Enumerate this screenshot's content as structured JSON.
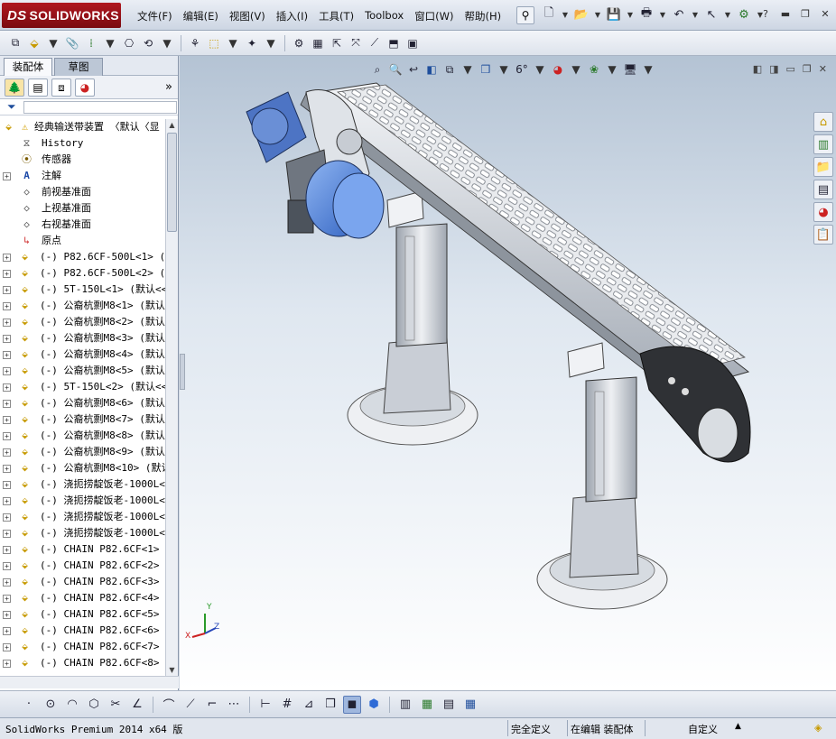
{
  "app": {
    "brand": "SOLIDWORKS",
    "brand_prefix": "DS"
  },
  "menu": [
    "文件(F)",
    "编辑(E)",
    "视图(V)",
    "插入(I)",
    "工具(T)",
    "Toolbox",
    "窗口(W)",
    "帮助(H)"
  ],
  "panel": {
    "tabs": [
      "装配体",
      "草图"
    ],
    "root": "经典输送带装置 〈默认〈显",
    "items": [
      {
        "icon": "history-icon",
        "label": "History",
        "expand": false
      },
      {
        "icon": "sensor-icon",
        "label": "传感器",
        "expand": false
      },
      {
        "icon": "annotation-icon",
        "label": "注解",
        "expand": true
      },
      {
        "icon": "plane-icon",
        "label": "前视基准面",
        "expand": false
      },
      {
        "icon": "plane-icon",
        "label": "上视基准面",
        "expand": false
      },
      {
        "icon": "plane-icon",
        "label": "右视基准面",
        "expand": false
      },
      {
        "icon": "origin-icon",
        "label": "原点",
        "expand": false
      },
      {
        "icon": "part-icon",
        "label": "(-) P82.6CF-500L<1> (默",
        "expand": true
      },
      {
        "icon": "part-icon",
        "label": "(-) P82.6CF-500L<2> (默",
        "expand": true
      },
      {
        "icon": "part-icon",
        "label": "(-) 5T-150L<1> (默认<<默",
        "expand": true
      },
      {
        "icon": "part-icon",
        "label": "(-) 公裔杭剽M8<1> (默认",
        "expand": true
      },
      {
        "icon": "part-icon",
        "label": "(-) 公裔杭剽M8<2> (默认",
        "expand": true
      },
      {
        "icon": "part-icon",
        "label": "(-) 公裔杭剽M8<3> (默认",
        "expand": true
      },
      {
        "icon": "part-icon",
        "label": "(-) 公裔杭剽M8<4> (默认",
        "expand": true
      },
      {
        "icon": "part-icon",
        "label": "(-) 公裔杭剽M8<5> (默认",
        "expand": true
      },
      {
        "icon": "part-icon",
        "label": "(-) 5T-150L<2> (默认<<默",
        "expand": true
      },
      {
        "icon": "part-icon",
        "label": "(-) 公裔杭剽M8<6> (默认",
        "expand": true
      },
      {
        "icon": "part-icon",
        "label": "(-) 公裔杭剽M8<7> (默认",
        "expand": true
      },
      {
        "icon": "part-icon",
        "label": "(-) 公裔杭剽M8<8> (默认",
        "expand": true
      },
      {
        "icon": "part-icon",
        "label": "(-) 公裔杭剽M8<9> (默认",
        "expand": true
      },
      {
        "icon": "part-icon",
        "label": "(-) 公裔杭剽M8<10> (默认",
        "expand": true
      },
      {
        "icon": "part-icon",
        "label": "(-) 浇扼捞靛饭老-1000L<",
        "expand": true
      },
      {
        "icon": "part-icon",
        "label": "(-) 浇扼捞靛饭老-1000L<",
        "expand": true
      },
      {
        "icon": "part-icon",
        "label": "(-) 浇扼捞靛饭老-1000L<",
        "expand": true
      },
      {
        "icon": "part-icon",
        "label": "(-) 浇扼捞靛饭老-1000L<",
        "expand": true
      },
      {
        "icon": "part-icon",
        "label": "(-) CHAIN P82.6CF<1> (默",
        "expand": true
      },
      {
        "icon": "part-icon",
        "label": "(-) CHAIN P82.6CF<2> (默",
        "expand": true
      },
      {
        "icon": "part-icon",
        "label": "(-) CHAIN P82.6CF<3> (默",
        "expand": true
      },
      {
        "icon": "part-icon",
        "label": "(-) CHAIN P82.6CF<4> (默",
        "expand": true
      },
      {
        "icon": "part-icon",
        "label": "(-) CHAIN P82.6CF<5> (默",
        "expand": true
      },
      {
        "icon": "part-icon",
        "label": "(-) CHAIN P82.6CF<6> (默",
        "expand": true
      },
      {
        "icon": "part-icon",
        "label": "(-) CHAIN P82.6CF<7> (默",
        "expand": true
      },
      {
        "icon": "part-icon",
        "label": "(-) CHAIN P82.6CF<8> (默",
        "expand": true
      }
    ]
  },
  "status": {
    "app_version": "SolidWorks Premium 2014 x64 版",
    "fully_defined": "完全定义",
    "editing": "在编辑 装配体",
    "units": "自定义"
  },
  "triad": {
    "x": "X",
    "y": "Y",
    "z": "Z"
  },
  "colors": {
    "brand": "#b01820",
    "viewport_top": "#b4c3d4",
    "viewport_bottom": "#ffffff",
    "motor": "#5b8fe0"
  }
}
